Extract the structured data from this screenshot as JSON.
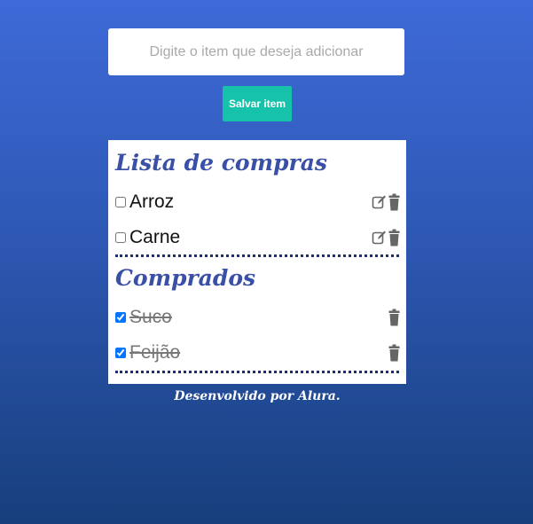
{
  "form": {
    "input_placeholder": "Digite o item que deseja adicionar",
    "input_value": "",
    "save_label": "Salvar item"
  },
  "pending_section": {
    "title": "Lista de compras",
    "items": [
      {
        "label": "Arroz",
        "checked": false
      },
      {
        "label": "Carne",
        "checked": false
      }
    ]
  },
  "bought_section": {
    "title": "Comprados",
    "items": [
      {
        "label": "Suco",
        "checked": true
      },
      {
        "label": "Feijão",
        "checked": true
      }
    ]
  },
  "footer": {
    "text": "Desenvolvido por Alura."
  },
  "colors": {
    "accent": "#16c2a9",
    "title": "#3a4fa6",
    "icon": "#666666"
  },
  "icons": {
    "edit": "edit-icon",
    "delete": "trash-icon"
  }
}
